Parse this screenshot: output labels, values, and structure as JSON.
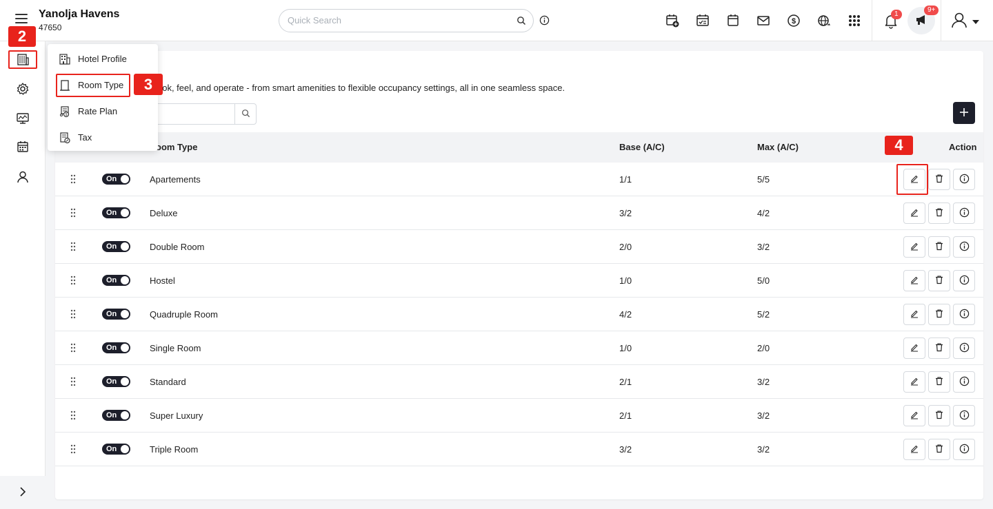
{
  "header": {
    "hotel_name": "Yanolja Havens",
    "hotel_id": "47650",
    "search_placeholder": "Quick Search",
    "notification_count": "1",
    "announcement_count": "9+",
    "icons": [
      "calendar-add-icon",
      "calendar-check-icon",
      "calendar-icon",
      "mail-icon",
      "dollar-icon",
      "globe-icon",
      "apps-grid-icon"
    ]
  },
  "sidebar": {
    "items": [
      "building-icon",
      "settings-icon",
      "monitor-icon",
      "calendar-grid-icon",
      "user-icon"
    ],
    "expand_icon": "chevron-right-icon"
  },
  "dropdown": {
    "items": [
      {
        "label": "Hotel Profile",
        "icon": "building-icon"
      },
      {
        "label": "Room Type",
        "icon": "door-icon"
      },
      {
        "label": "Rate Plan",
        "icon": "rate-icon"
      },
      {
        "label": "Tax",
        "icon": "tax-icon"
      }
    ]
  },
  "page": {
    "description": "ook, feel, and operate - from smart amenities to flexible occupancy settings, all in one seamless space."
  },
  "table": {
    "headers": {
      "room_type": "oom Type",
      "base": "Base (A/C)",
      "max": "Max (A/C)",
      "action": "Action"
    },
    "rows": [
      {
        "status": "On",
        "name": "Apartements",
        "base": "1/1",
        "max": "5/5"
      },
      {
        "status": "On",
        "name": "Deluxe",
        "base": "3/2",
        "max": "4/2"
      },
      {
        "status": "On",
        "name": "Double Room",
        "base": "2/0",
        "max": "3/2"
      },
      {
        "status": "On",
        "name": "Hostel",
        "base": "1/0",
        "max": "5/0"
      },
      {
        "status": "On",
        "name": "Quadruple Room",
        "base": "4/2",
        "max": "5/2"
      },
      {
        "status": "On",
        "name": "Single Room",
        "base": "1/0",
        "max": "2/0"
      },
      {
        "status": "On",
        "name": "Standard",
        "base": "2/1",
        "max": "3/2"
      },
      {
        "status": "On",
        "name": "Super Luxury",
        "base": "2/1",
        "max": "3/2"
      },
      {
        "status": "On",
        "name": "Triple Room",
        "base": "3/2",
        "max": "3/2"
      }
    ]
  },
  "markers": {
    "m2": "2",
    "m3": "3",
    "m4": "4"
  },
  "colors": {
    "accent": "#1d1f2b",
    "marker": "#e8231c",
    "badge": "#f04b4b"
  }
}
